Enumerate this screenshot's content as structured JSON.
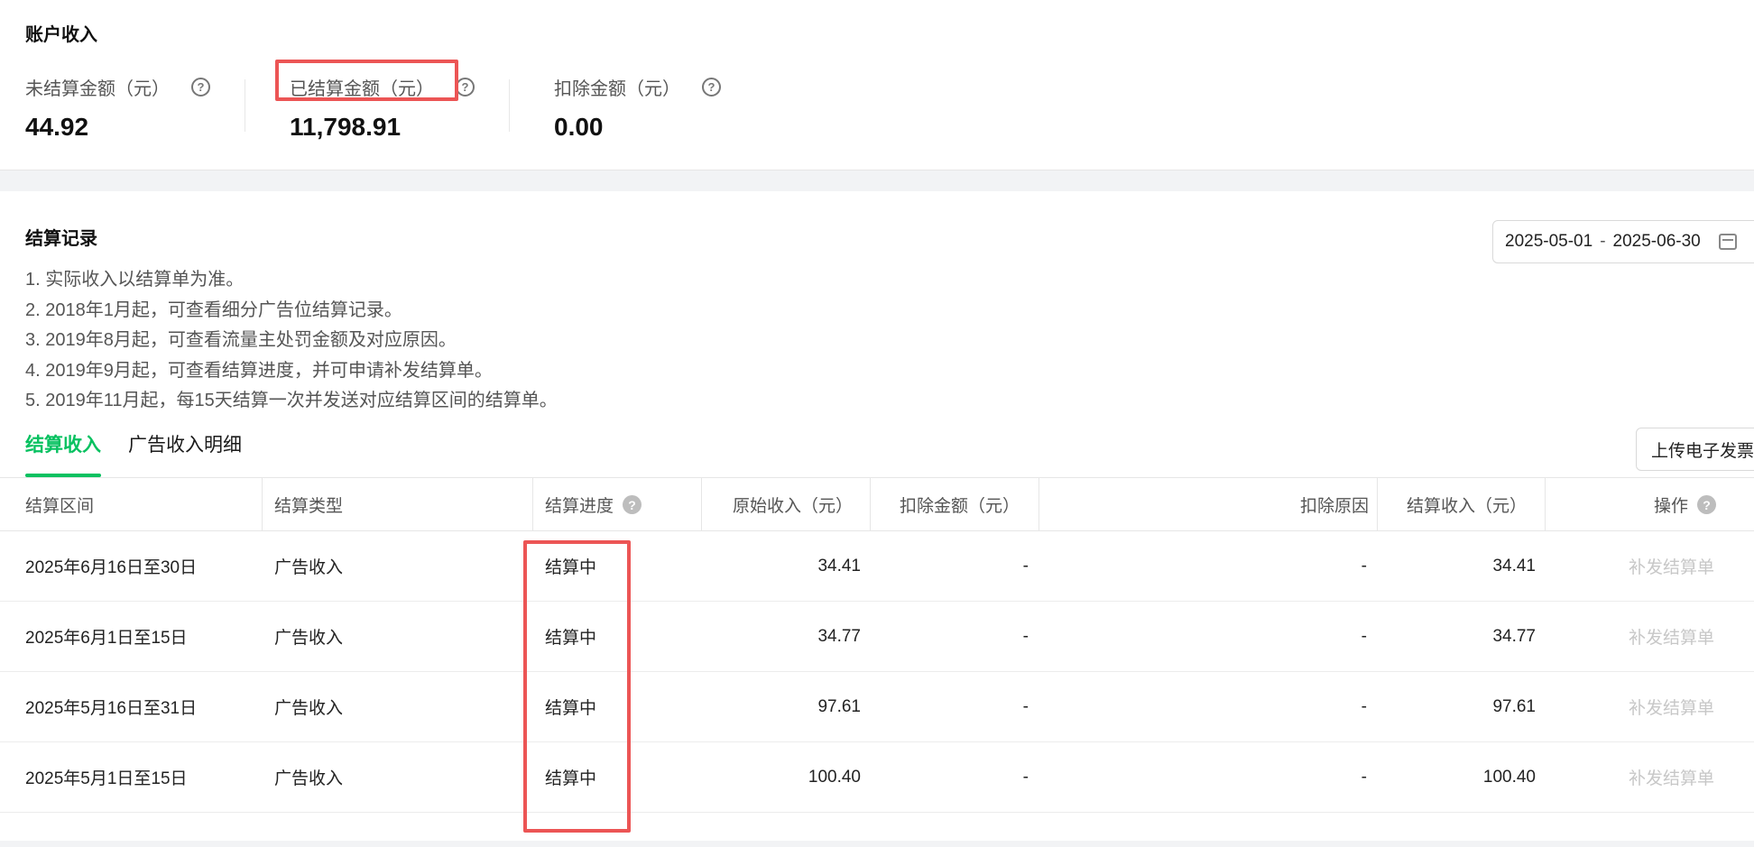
{
  "account": {
    "title": "账户收入",
    "stats": [
      {
        "label": "未结算金额（元）",
        "value": "44.92"
      },
      {
        "label": "已结算金额（元）",
        "value": "11,798.91"
      },
      {
        "label": "扣除金额（元）",
        "value": "0.00"
      }
    ],
    "help_glyph": "?"
  },
  "records": {
    "title": "结算记录",
    "date_range": {
      "start": "2025-05-01",
      "separator": "-",
      "end": "2025-06-30"
    },
    "notes": [
      "1. 实际收入以结算单为准。",
      "2. 2018年1月起，可查看细分广告位结算记录。",
      "3. 2019年8月起，可查看流量主处罚金额及对应原因。",
      "4. 2019年9月起，可查看结算进度，并可申请补发结算单。",
      "5. 2019年11月起，每15天结算一次并发送对应结算区间的结算单。"
    ],
    "tabs": [
      {
        "label": "结算收入",
        "active": true
      },
      {
        "label": "广告收入明细",
        "active": false
      }
    ],
    "upload_button": "上传电子发票"
  },
  "table": {
    "columns": [
      "结算区间",
      "结算类型",
      "结算进度",
      "原始收入（元）",
      "扣除金额（元）",
      "扣除原因",
      "结算收入（元）",
      "操作"
    ],
    "rows": [
      {
        "period": "2025年6月16日至30日",
        "type": "广告收入",
        "progress": "结算中",
        "original": "34.41",
        "deduction": "-",
        "reason": "-",
        "income": "34.41",
        "action": "补发结算单"
      },
      {
        "period": "2025年6月1日至15日",
        "type": "广告收入",
        "progress": "结算中",
        "original": "34.77",
        "deduction": "-",
        "reason": "-",
        "income": "34.77",
        "action": "补发结算单"
      },
      {
        "period": "2025年5月16日至31日",
        "type": "广告收入",
        "progress": "结算中",
        "original": "97.61",
        "deduction": "-",
        "reason": "-",
        "income": "97.61",
        "action": "补发结算单"
      },
      {
        "period": "2025年5月1日至15日",
        "type": "广告收入",
        "progress": "结算中",
        "original": "100.40",
        "deduction": "-",
        "reason": "-",
        "income": "100.40",
        "action": "补发结算单"
      }
    ]
  },
  "colors": {
    "accent_green": "#07c160",
    "highlight_red": "#ec5555"
  },
  "icons": [
    "question-circle-icon",
    "calendar-icon"
  ]
}
